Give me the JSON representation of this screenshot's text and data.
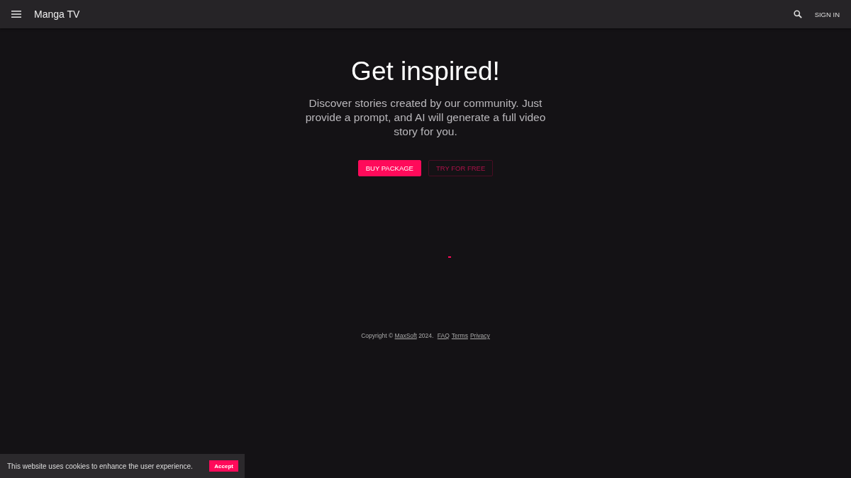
{
  "header": {
    "title": "Manga TV",
    "sign_in": "SIGN IN"
  },
  "hero": {
    "title": "Get inspired!",
    "text": "Discover stories created by our community. Just provide a prompt, and AI will generate a full video story for you.",
    "buttons": [
      {
        "label": "BUY PACKAGE",
        "kind": "primary"
      },
      {
        "label": "TRY FOR FREE",
        "kind": "outline"
      }
    ]
  },
  "loading": true,
  "footer": {
    "parts": [
      {
        "kind": "text",
        "text": "Copyright © "
      },
      {
        "kind": "link",
        "text": "MaxSoft"
      },
      {
        "kind": "text",
        "text": " 2024. "
      },
      {
        "kind": "link",
        "text": "FAQ"
      },
      {
        "kind": "link",
        "text": "Terms"
      },
      {
        "kind": "link",
        "text": "Privacy"
      }
    ]
  },
  "cookie_banner": {
    "text": "This website uses cookies to enhance the user experience.",
    "button": "Accept"
  }
}
